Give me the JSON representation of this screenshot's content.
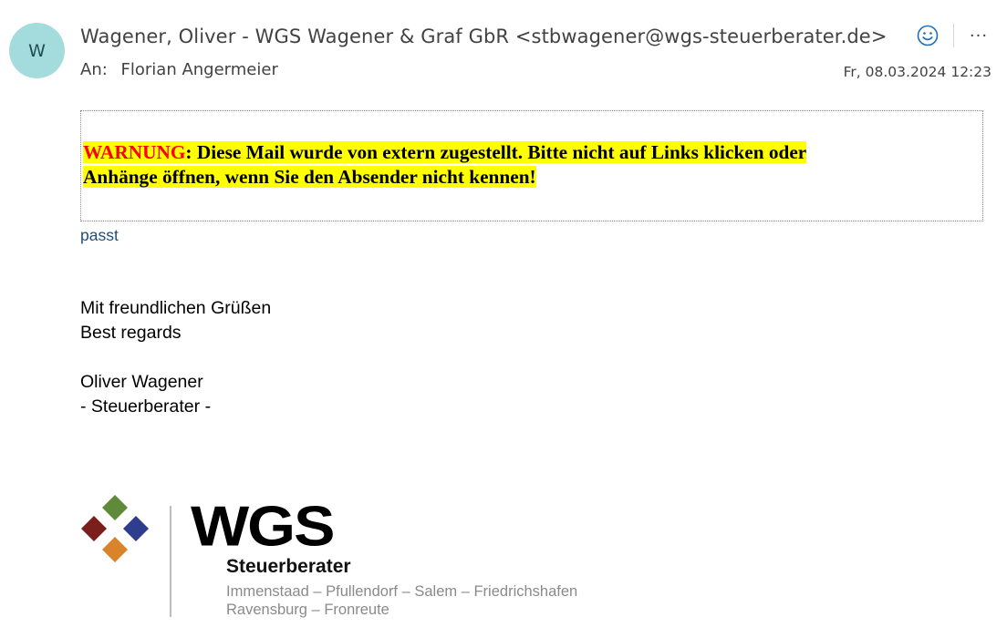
{
  "header": {
    "avatar_initial": "W",
    "sender": "Wagener, Oliver - WGS Wagener & Graf GbR <stbwagener@wgs-steuerberater.de>",
    "to_label": "An:",
    "recipient": "Florian Angermeier",
    "datetime": "Fr, 08.03.2024 12:23",
    "actions": {
      "emoji_icon": "smiley-icon",
      "more_icon": "more-icon",
      "more_glyph": "···"
    }
  },
  "warning": {
    "keyword": "WARNUNG",
    "line1_rest": ": Diese Mail wurde von extern zugestellt. Bitte nicht auf Links klicken oder",
    "line2": "Anhänge öffnen, wenn Sie den Absender nicht kennen!",
    "colors": {
      "highlight": "#ffff00",
      "keyword": "#ff0000"
    }
  },
  "body": {
    "reply": "passt",
    "signature": {
      "greeting_de": "Mit freundlichen Grüßen",
      "greeting_en": "Best regards",
      "name": "Oliver Wagener",
      "title": "- Steuerberater -"
    }
  },
  "logo": {
    "brand": "WGS",
    "subtitle": "Steuerberater",
    "locations_line1": "Immenstaad – Pfullendorf – Salem – Friedrichshafen",
    "locations_line2": "Ravensburg – Fronreute",
    "diamond_colors": [
      "#5f8a3a",
      "#7b1f1c",
      "#2f3d8f",
      "#d9832b"
    ]
  }
}
